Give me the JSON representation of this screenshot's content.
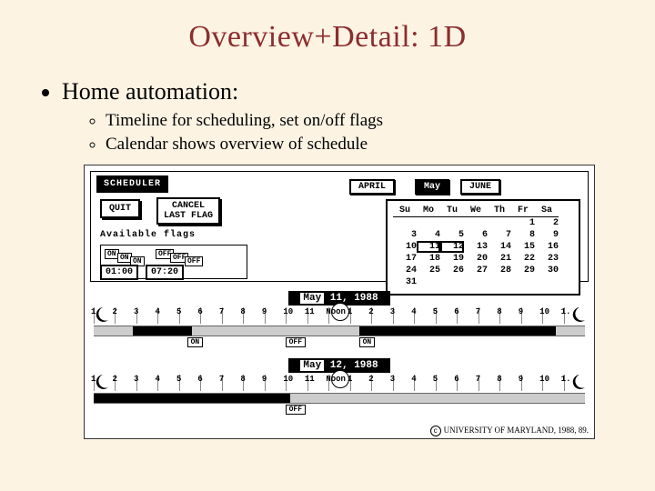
{
  "title": "Overview+Detail:  1D",
  "bullets": {
    "main": "Home automation:",
    "sub1": "Timeline for scheduling, set on/off flags",
    "sub2": "Calendar shows overview of schedule"
  },
  "scheduler": {
    "label": "SCHEDULER",
    "quit": "QUIT",
    "cancel": "CANCEL\nLAST FLAG",
    "available_label": "Available flags",
    "flags": {
      "on": "ON",
      "off": "OFF"
    },
    "time1": "01:00",
    "time2": "07:20",
    "months": {
      "prev": "APRIL",
      "cur": "May",
      "next": "JUNE"
    },
    "calendar": {
      "headers": [
        "Su",
        "Mo",
        "Tu",
        "We",
        "Th",
        "Fr",
        "Sa"
      ],
      "rows": [
        [
          "",
          "",
          "",
          "",
          "",
          "1",
          "2"
        ],
        [
          "3",
          "4",
          "5",
          "6",
          "7",
          "8",
          "9"
        ],
        [
          "10",
          "11",
          "12",
          "13",
          "14",
          "15",
          "16"
        ],
        [
          "17",
          "18",
          "19",
          "20",
          "21",
          "22",
          "23"
        ],
        [
          "24",
          "25",
          "26",
          "27",
          "28",
          "29",
          "30"
        ],
        [
          "31",
          "",
          "",
          "",
          "",
          "",
          ""
        ]
      ],
      "selected": [
        "11",
        "12"
      ]
    },
    "timeline": {
      "date1": "May 11, 1988",
      "date2": "May 12, 1988",
      "hours": [
        "1",
        "2",
        "3",
        "4",
        "5",
        "6",
        "7",
        "8",
        "9",
        "10",
        "11",
        "Noon",
        "1",
        "2",
        "3",
        "4",
        "5",
        "6",
        "7",
        "8",
        "9",
        "10",
        "1."
      ],
      "row1_chips": [
        {
          "label": "ON",
          "left": "19%"
        },
        {
          "label": "OFF",
          "left": "39%"
        },
        {
          "label": "ON",
          "left": "54%"
        }
      ],
      "row2_chips": [
        {
          "label": "OFF",
          "left": "39%"
        }
      ]
    }
  },
  "credit": "UNIVERSITY OF MARYLAND, 1988, 89."
}
